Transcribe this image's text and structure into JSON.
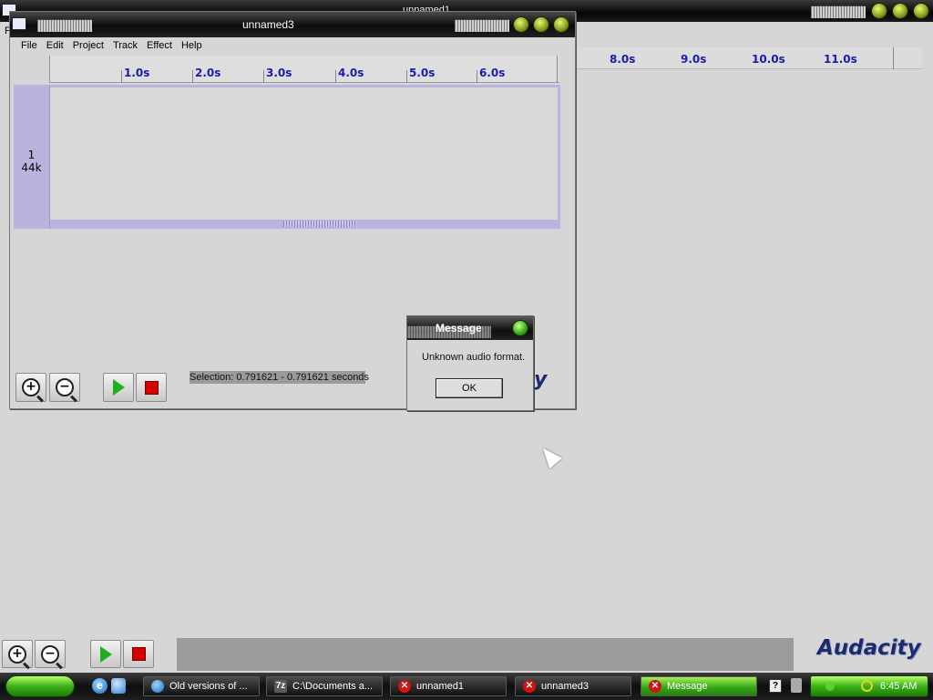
{
  "background_window": {
    "title": "unnamed1",
    "ruler_ticks": [
      "8.0s",
      "9.0s",
      "10.0s",
      "11.0s"
    ],
    "menu_fragment": "F"
  },
  "main_window": {
    "title": "unnamed3",
    "menu": [
      "File",
      "Edit",
      "Project",
      "Track",
      "Effect",
      "Help"
    ],
    "ruler_ticks": [
      "1.0s",
      "2.0s",
      "3.0s",
      "4.0s",
      "5.0s",
      "6.0s"
    ],
    "track": {
      "channel": "1",
      "rate": "44k"
    },
    "selection_text": "Selection: 0.791621 - 0.791621 seconds",
    "logo_partial": "y"
  },
  "dialog": {
    "title": "Message",
    "message": "Unknown audio format.",
    "ok_label": "OK"
  },
  "bottom_toolbar": {
    "logo": "Audacity"
  },
  "taskbar": {
    "tasks": [
      {
        "label": "Old versions of ...",
        "icon": "globe-icon",
        "active": false
      },
      {
        "label": "C:\\Documents a...",
        "icon": "archive-icon",
        "active": false
      },
      {
        "label": "unnamed1",
        "icon": "error-icon",
        "active": false
      },
      {
        "label": "unnamed3",
        "icon": "error-icon",
        "active": false
      },
      {
        "label": "Message",
        "icon": "error-icon",
        "active": true
      }
    ],
    "clock": "6:45 AM"
  },
  "colors": {
    "ruler_text": "#1b1bb0",
    "track_border": "#b8b4de",
    "stop_red": "#d40000",
    "play_green": "#1fb01f",
    "taskbar_active": "#38a818"
  }
}
